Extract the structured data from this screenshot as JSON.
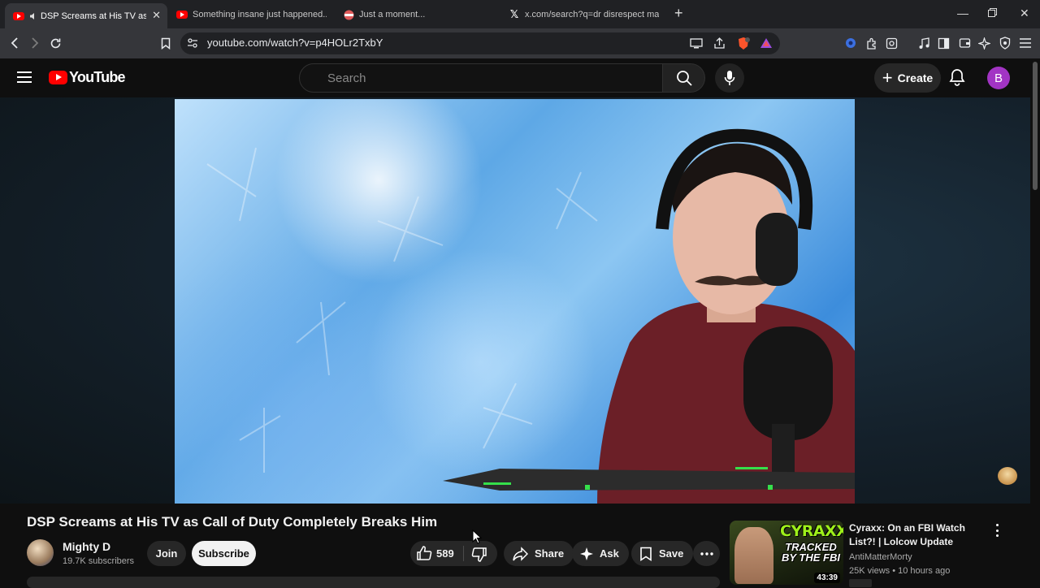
{
  "browser": {
    "tabs": [
      {
        "title": "DSP Screams at His TV as Cal",
        "active": true
      },
      {
        "title": "Something insane just happened.. - Y",
        "active": false
      },
      {
        "title": "Just a moment...",
        "active": false
      },
      {
        "title": "x.com/search?q=dr disrespect madu",
        "active": false
      }
    ],
    "url": "youtube.com/watch?v=p4HOLr2TxbY"
  },
  "yt": {
    "logo_text": "YouTube",
    "search_placeholder": "Search",
    "create_label": "Create",
    "avatar_letter": "B"
  },
  "video": {
    "title": "DSP Screams at His TV as Call of Duty Completely Breaks Him",
    "channel": "Mighty D",
    "subscribers": "19.7K subscribers",
    "join_label": "Join",
    "subscribe_label": "Subscribe",
    "likes": "589",
    "share_label": "Share",
    "ask_label": "Ask",
    "save_label": "Save"
  },
  "recommendation": {
    "title": "Cyraxx: On an FBI Watch List?! | Lolcow Update",
    "channel": "AntiMatterMorty",
    "meta": "25K views • 10 hours ago",
    "duration": "43:39",
    "thumb_text_1": "CYRAXX",
    "thumb_text_2": "TRACKED BY THE FBI"
  }
}
